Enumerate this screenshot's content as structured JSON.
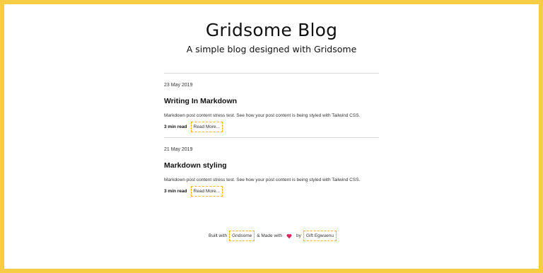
{
  "header": {
    "title": "Gridsome Blog",
    "subtitle": "A simple blog designed with Gridsome"
  },
  "posts": [
    {
      "date": "23 May 2019",
      "title": "Writing In Markdown",
      "excerpt": "Markdown post content stress test. See how your post content is being styled with Tailwind CSS.",
      "read_time": "3 min read",
      "read_more": "Read More..."
    },
    {
      "date": "21 May 2019",
      "title": "Markdown styling",
      "excerpt": "Markdown post content stress test. See how your post content is being styled with Tailwind CSS.",
      "read_time": "3 min read",
      "read_more": "Read More..."
    }
  ],
  "footer": {
    "built_with": "Built with",
    "gridsome_link": "Gridsome",
    "made_with": "& Made with",
    "heart_icon": "heart-icon",
    "by": "by",
    "author_link": "Gift Egwuenu"
  },
  "colors": {
    "frame": "#f8cc43",
    "link_border": "#f8b500",
    "heart": "#e0245e"
  }
}
